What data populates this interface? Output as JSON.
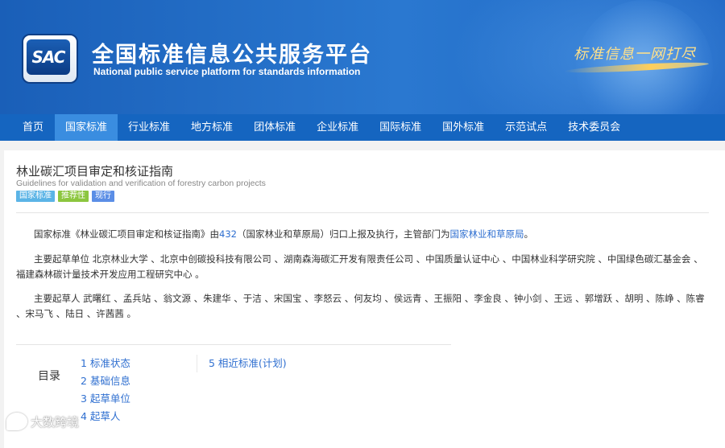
{
  "header": {
    "logo_text": "SAC",
    "title_cn": "全国标准信息公共服务平台",
    "title_en": "National public service platform  for standards information",
    "slogan": "标准信息一网打尽"
  },
  "nav": {
    "items": [
      {
        "label": "首页"
      },
      {
        "label": "国家标准"
      },
      {
        "label": "行业标准"
      },
      {
        "label": "地方标准"
      },
      {
        "label": "团体标准"
      },
      {
        "label": "企业标准"
      },
      {
        "label": "国际标准"
      },
      {
        "label": "国外标准"
      },
      {
        "label": "示范试点"
      },
      {
        "label": "技术委员会"
      }
    ],
    "active_index": 1
  },
  "document": {
    "title": "林业碳汇项目审定和核证指南",
    "title_en": "Guidelines for validation and verification of forestry carbon projects",
    "tags": [
      {
        "label": "国家标准",
        "color": "#5bb4e6"
      },
      {
        "label": "推荐性",
        "color": "#8cc63f"
      },
      {
        "label": "现行",
        "color": "#5b8ee6"
      }
    ],
    "intro": {
      "part1": "国家标准《林业碳汇项目审定和核证指南》由",
      "tc_code": "432",
      "part2": "（国家林业和草原局）归口上报及执行，主管部门为",
      "authority": "国家林业和草原局",
      "part3": "。"
    },
    "drafting_units_label": "主要起草单位",
    "drafting_units": "北京林业大学 、北京中创碳投科技有限公司 、湖南森海碳汇开发有限责任公司 、中国质量认证中心 、中国林业科学研究院 、中国绿色碳汇基金会 、福建森林碳计量技术开发应用工程研究中心 。",
    "drafters_label": "主要起草人",
    "drafters": "武曙红 、孟兵站 、翁文源 、朱建华 、于洁 、宋国宝 、李怒云 、何友均 、侯远青 、王振阳 、李金良 、钟小剑 、王远 、郭增跃 、胡明 、陈峥 、陈睿 、宋马飞 、陆日 、许茜茜 。"
  },
  "toc": {
    "heading": "目录",
    "col1": [
      "1 标准状态",
      "2 基础信息",
      "3 起草单位",
      "4 起草人"
    ],
    "col2": [
      "5 相近标准(计划)"
    ]
  },
  "watermark": "大数跨境",
  "colors": {
    "banner": "#1a5fb8",
    "nav": "#1565c0",
    "nav_active": "#3a8de0",
    "link": "#2f6fd0"
  }
}
